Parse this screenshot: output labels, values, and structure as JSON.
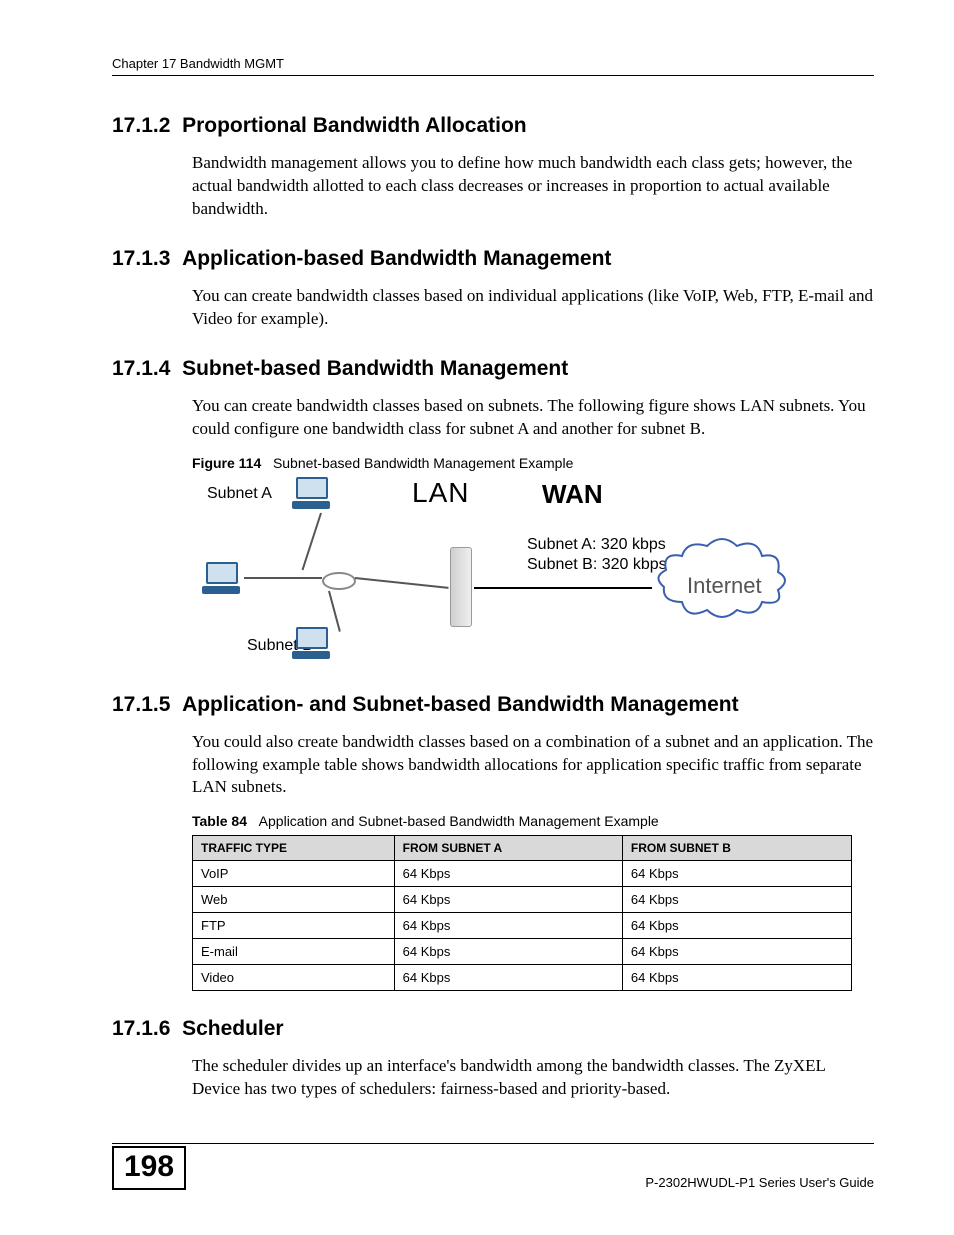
{
  "header": {
    "chapter": "Chapter 17 Bandwidth MGMT"
  },
  "sections": {
    "s2": {
      "num": "17.1.2",
      "title": "Proportional Bandwidth Allocation",
      "p1": "Bandwidth management allows you to define how much bandwidth each class gets; however, the actual bandwidth allotted to each class decreases or increases in proportion to actual available bandwidth."
    },
    "s3": {
      "num": "17.1.3",
      "title": "Application-based Bandwidth Management",
      "p1": "You can create bandwidth classes based on individual applications (like VoIP, Web, FTP, E-mail and Video for example)."
    },
    "s4": {
      "num": "17.1.4",
      "title": "Subnet-based Bandwidth Management",
      "p1": "You can create bandwidth classes based on subnets. The following figure shows LAN subnets. You could configure one bandwidth class for subnet A and another for subnet B.",
      "figlabel": "Figure 114",
      "figtitle": "Subnet-based Bandwidth Management Example",
      "fig": {
        "lan": "LAN",
        "wan": "WAN",
        "subnetA": "Subnet A",
        "subnetB": "Subnet B",
        "rateA": "Subnet A: 320 kbps",
        "rateB": "Subnet B: 320 kbps",
        "internet": "Internet"
      }
    },
    "s5": {
      "num": "17.1.5",
      "title": "Application- and Subnet-based Bandwidth Management",
      "p1": "You could also create bandwidth classes based on a combination of a subnet and an application. The following example table shows bandwidth allocations for application specific traffic from separate LAN subnets.",
      "tbllabel": "Table 84",
      "tbltitle": "Application and Subnet-based Bandwidth Management Example",
      "table": {
        "h1": "TRAFFIC TYPE",
        "h2": "FROM SUBNET A",
        "h3": "FROM SUBNET B",
        "rows": [
          {
            "c1": "VoIP",
            "c2": "64 Kbps",
            "c3": "64 Kbps"
          },
          {
            "c1": "Web",
            "c2": "64 Kbps",
            "c3": "64 Kbps"
          },
          {
            "c1": "FTP",
            "c2": "64 Kbps",
            "c3": "64 Kbps"
          },
          {
            "c1": "E-mail",
            "c2": "64 Kbps",
            "c3": "64 Kbps"
          },
          {
            "c1": "Video",
            "c2": "64 Kbps",
            "c3": "64 Kbps"
          }
        ]
      }
    },
    "s6": {
      "num": "17.1.6",
      "title": "Scheduler",
      "p1": "The scheduler divides up an interface's bandwidth among the bandwidth classes. The ZyXEL Device has two types of schedulers: fairness-based and priority-based."
    }
  },
  "footer": {
    "page": "198",
    "guide": "P-2302HWUDL-P1 Series User's Guide"
  }
}
